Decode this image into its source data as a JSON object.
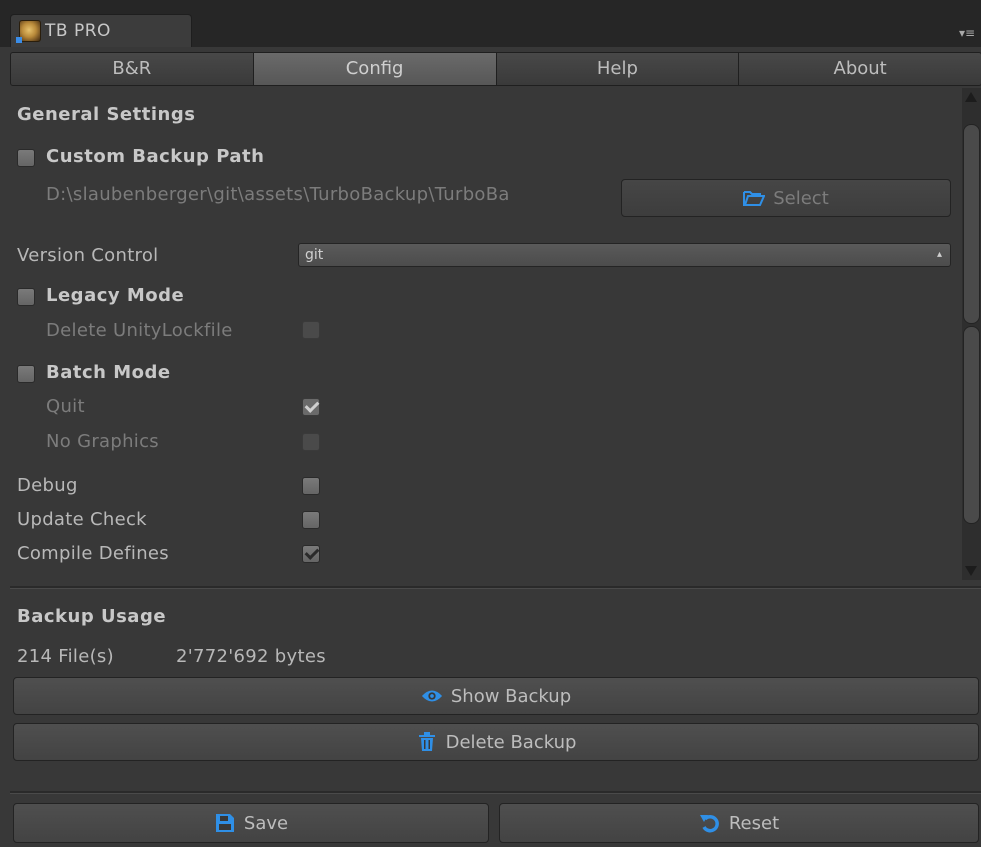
{
  "window": {
    "title": "TB PRO",
    "icon": "turbo-backup-logo-icon",
    "menu_icon": "window-menu-icon"
  },
  "tabs": [
    {
      "label": "B&R",
      "active": false
    },
    {
      "label": "Config",
      "active": true
    },
    {
      "label": "Help",
      "active": false
    },
    {
      "label": "About",
      "active": false
    }
  ],
  "general": {
    "heading": "General Settings",
    "custom_backup_path": {
      "label": "Custom Backup Path",
      "checked": false,
      "path": "D:\\slaubenberger\\git\\assets\\TurboBackup\\TurboBa",
      "select_label": "Select",
      "select_icon": "folder-open-icon"
    },
    "version_control": {
      "label": "Version Control",
      "value": "git"
    },
    "legacy_mode": {
      "label": "Legacy Mode",
      "checked": false,
      "delete_lockfile_label": "Delete UnityLockfile",
      "delete_lockfile_checked": false
    },
    "batch_mode": {
      "label": "Batch Mode",
      "checked": false,
      "quit_label": "Quit",
      "quit_checked": true,
      "no_graphics_label": "No Graphics",
      "no_graphics_checked": false
    },
    "debug": {
      "label": "Debug",
      "checked": false
    },
    "update_check": {
      "label": "Update Check",
      "checked": false
    },
    "compile_defines": {
      "label": "Compile Defines",
      "checked": true
    }
  },
  "usage": {
    "heading": "Backup Usage",
    "files": "214 File(s)",
    "bytes": "2'772'692 bytes",
    "show_label": "Show Backup",
    "show_icon": "eye-icon",
    "delete_label": "Delete Backup",
    "delete_icon": "trash-icon"
  },
  "footer": {
    "save_label": "Save",
    "save_icon": "floppy-disk-icon",
    "reset_label": "Reset",
    "reset_icon": "undo-icon"
  },
  "colors": {
    "accent": "#2f8fe6",
    "background": "#383838",
    "titlebar": "#262626"
  }
}
